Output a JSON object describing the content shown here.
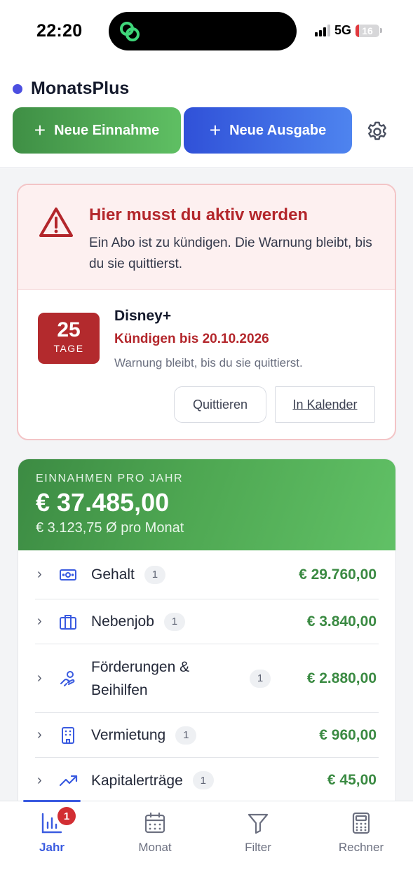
{
  "status_bar": {
    "time": "22:20",
    "network": "5G",
    "battery": "16",
    "battery_level": 0.16
  },
  "header": {
    "app_name": "MonatsPlus",
    "new_income_label": "Neue Einnahme",
    "new_expense_label": "Neue Ausgabe",
    "settings_icon": "gear-icon"
  },
  "alert": {
    "title": "Hier musst du aktiv werden",
    "message": "Ein Abo ist zu kündigen. Die Warnung bleibt, bis du sie quittierst.",
    "item": {
      "days": "25",
      "days_label": "TAGE",
      "name": "Disney+",
      "deadline": "Kündigen bis 20.10.2026",
      "note": "Warnung bleibt, bis du sie quittierst.",
      "acknowledge_label": "Quittieren",
      "calendar_label": "In Kalender"
    },
    "colors": {
      "accent": "#b3262b",
      "background": "#fdf0f0"
    }
  },
  "income": {
    "label": "EINNAHMEN PRO JAHR",
    "total": "€ 37.485,00",
    "average": "€ 3.123,75 Ø pro Monat",
    "accent": "#3a8a42",
    "categories": [
      {
        "name": "Gehalt",
        "count": "1",
        "amount": "€ 29.760,00",
        "icon": "banknote-icon"
      },
      {
        "name": "Nebenjob",
        "count": "1",
        "amount": "€ 3.840,00",
        "icon": "briefcase-icon"
      },
      {
        "name": "Förderungen & Beihilfen",
        "count": "1",
        "amount": "€ 2.880,00",
        "icon": "hand-coins-icon"
      },
      {
        "name": "Vermietung",
        "count": "1",
        "amount": "€ 960,00",
        "icon": "building-icon"
      },
      {
        "name": "Kapitalerträge",
        "count": "1",
        "amount": "€ 45,00",
        "icon": "trending-up-icon"
      }
    ]
  },
  "nav": {
    "items": [
      {
        "label": "Jahr",
        "icon": "bar-chart-icon",
        "active": true,
        "badge": "1"
      },
      {
        "label": "Monat",
        "icon": "calendar-icon",
        "active": false
      },
      {
        "label": "Filter",
        "icon": "filter-icon",
        "active": false
      },
      {
        "label": "Rechner",
        "icon": "calculator-icon",
        "active": false
      }
    ],
    "active_color": "#3a5be0"
  }
}
